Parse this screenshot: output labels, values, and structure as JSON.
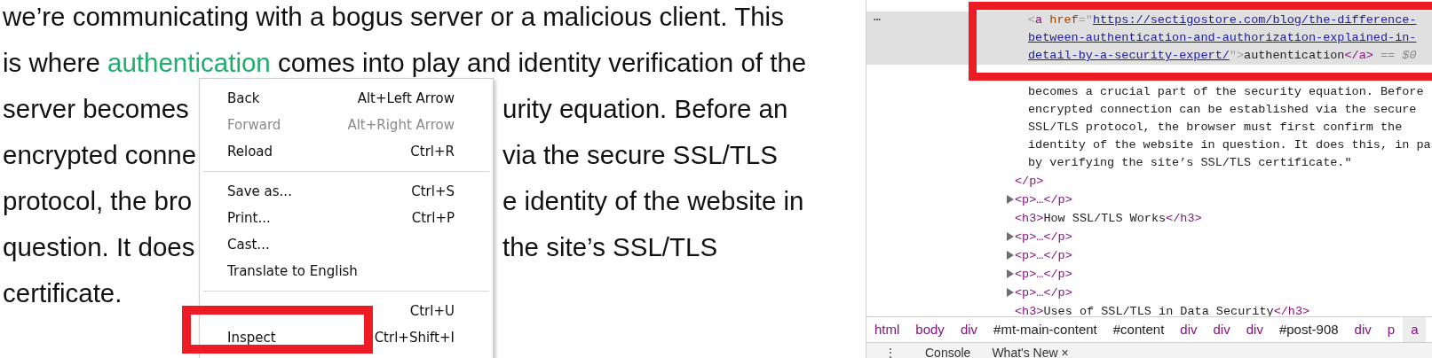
{
  "article": {
    "lines": [
      {
        "kind": "full",
        "text": "we’re communicating with a bogus server or a malicious client. This"
      },
      {
        "kind": "link",
        "before": "is where ",
        "link": "authentication",
        "after": " comes into play and identity verification of the"
      },
      {
        "kind": "split",
        "left": "server becomes",
        "right": "urity equation. Before an"
      },
      {
        "kind": "split",
        "left": "encrypted conne",
        "right": "via the secure SSL/TLS"
      },
      {
        "kind": "split",
        "left": "protocol, the bro",
        "right": "e identity of the website in"
      },
      {
        "kind": "split",
        "left": "question. It does",
        "right": "the site’s SSL/TLS"
      },
      {
        "kind": "full",
        "text": "certificate."
      }
    ]
  },
  "context_menu": {
    "groups": [
      [
        {
          "label": "Back",
          "shortcut": "Alt+Left Arrow",
          "disabled": false
        },
        {
          "label": "Forward",
          "shortcut": "Alt+Right Arrow",
          "disabled": true
        },
        {
          "label": "Reload",
          "shortcut": "Ctrl+R",
          "disabled": false
        }
      ],
      [
        {
          "label": "Save as...",
          "shortcut": "Ctrl+S",
          "disabled": false
        },
        {
          "label": "Print...",
          "shortcut": "Ctrl+P",
          "disabled": false
        },
        {
          "label": "Cast...",
          "disabled": false
        },
        {
          "label": "Translate to English",
          "disabled": false
        }
      ],
      [
        {
          "shortcut": "Ctrl+U",
          "disabled": false
        },
        {
          "label": "Inspect",
          "shortcut": "Ctrl+Shift+I",
          "disabled": false
        }
      ]
    ]
  },
  "devtools": {
    "more_button": "⋯",
    "tree": [
      {
        "kind": "element",
        "close": "</p>",
        "children": [
          {
            "kind": "link",
            "selected": true,
            "open": "<a",
            "attribute": "href",
            "equals": "=\"",
            "url_lines": [
              "https://sectigostore.com/blog/the-difference-",
              "between-authentication-and-authorization-explained-in-",
              "detail-by-a-security-expert/"
            ],
            "open_end": "\">",
            "text": "authentication",
            "close": "</a>",
            "marker": "== $0"
          },
          {
            "kind": "text",
            "lines": [
              "becomes a crucial part of the security equation. Before",
              "encrypted connection can be established via the secure",
              "SSL/TLS protocol, the browser must first confirm the",
              "identity of the website in question. It does this, in pa",
              "by verifying the site’s SSL/TLS certificate.\""
            ]
          }
        ]
      },
      {
        "kind": "collapsed",
        "markup": "<p>…</p>",
        "expanded": false
      },
      {
        "kind": "heading",
        "open": "<h3>",
        "text": "How SSL/TLS Works",
        "close": "</h3>"
      },
      {
        "kind": "collapsed",
        "markup": "<p>…</p>",
        "expanded": false
      },
      {
        "kind": "collapsed",
        "markup": "<p>…</p>",
        "expanded": false
      },
      {
        "kind": "collapsed",
        "markup": "<p>…</p>",
        "expanded": false
      },
      {
        "kind": "collapsed",
        "markup": "<p>…</p>",
        "expanded": false
      },
      {
        "kind": "heading",
        "open": "<h3>",
        "text": "Uses of SSL/TLS in Data Security",
        "close": "</h3>"
      }
    ],
    "breadcrumbs": [
      {
        "label": "html",
        "kind": "tag",
        "selected": false
      },
      {
        "label": "body",
        "kind": "tag",
        "selected": false
      },
      {
        "label": "div",
        "kind": "tag",
        "selected": false
      },
      {
        "label": "#mt-main-content",
        "kind": "id",
        "selected": false
      },
      {
        "label": "#content",
        "kind": "id",
        "selected": false
      },
      {
        "label": "div",
        "kind": "tag",
        "selected": false
      },
      {
        "label": "div",
        "kind": "tag",
        "selected": false
      },
      {
        "label": "div",
        "kind": "tag",
        "selected": false
      },
      {
        "label": "#post-908",
        "kind": "id",
        "selected": false
      },
      {
        "label": "div",
        "kind": "tag",
        "selected": false
      },
      {
        "label": "p",
        "kind": "tag",
        "selected": false
      },
      {
        "label": "a",
        "kind": "tag",
        "selected": true
      }
    ],
    "drawer": {
      "menu": "⋮",
      "tabs": [
        {
          "label": "Console",
          "closable": false
        },
        {
          "label": "What's New",
          "close": "×",
          "closable": true
        }
      ]
    }
  }
}
